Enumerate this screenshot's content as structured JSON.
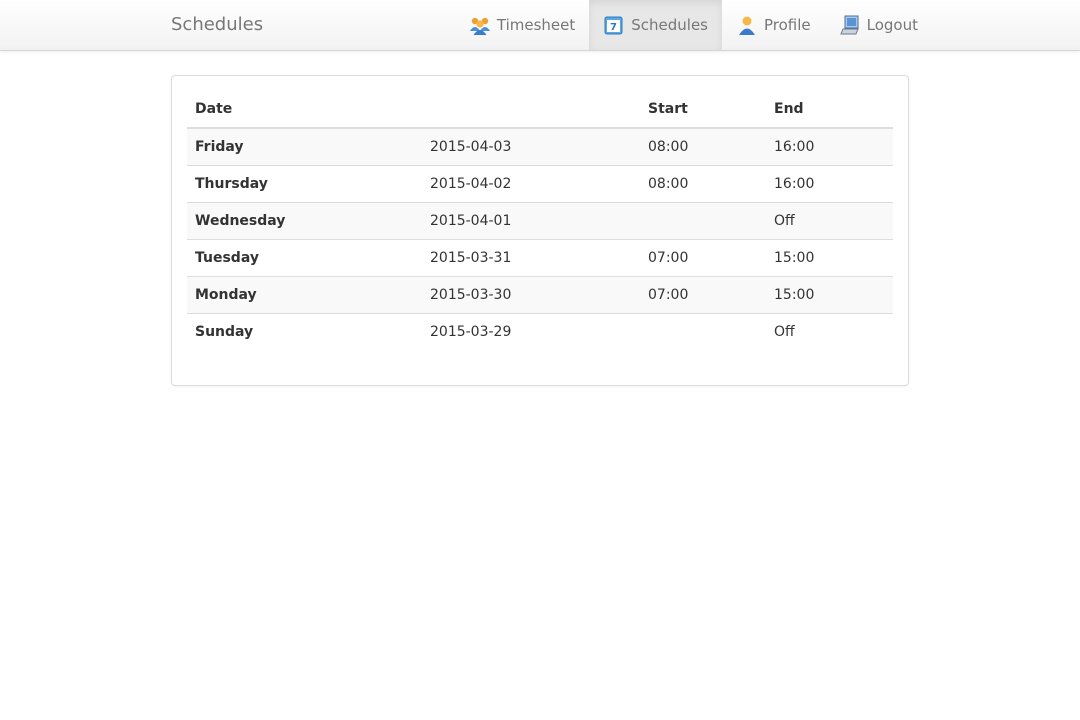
{
  "navbar": {
    "brand": "Schedules",
    "items": [
      {
        "label": "Timesheet",
        "icon": "users-icon",
        "active": false
      },
      {
        "label": "Schedules",
        "icon": "calendar-icon",
        "active": true
      },
      {
        "label": "Profile",
        "icon": "user-icon",
        "active": false
      },
      {
        "label": "Logout",
        "icon": "computer-icon",
        "active": false
      }
    ]
  },
  "table": {
    "headers": {
      "date": "Date",
      "start": "Start",
      "end": "End"
    },
    "rows": [
      {
        "day": "Friday",
        "date": "2015-04-03",
        "start": "08:00",
        "end": "16:00"
      },
      {
        "day": "Thursday",
        "date": "2015-04-02",
        "start": "08:00",
        "end": "16:00"
      },
      {
        "day": "Wednesday",
        "date": "2015-04-01",
        "start": "",
        "end": "Off"
      },
      {
        "day": "Tuesday",
        "date": "2015-03-31",
        "start": "07:00",
        "end": "15:00"
      },
      {
        "day": "Monday",
        "date": "2015-03-30",
        "start": "07:00",
        "end": "15:00"
      },
      {
        "day": "Sunday",
        "date": "2015-03-29",
        "start": "",
        "end": "Off"
      }
    ]
  }
}
